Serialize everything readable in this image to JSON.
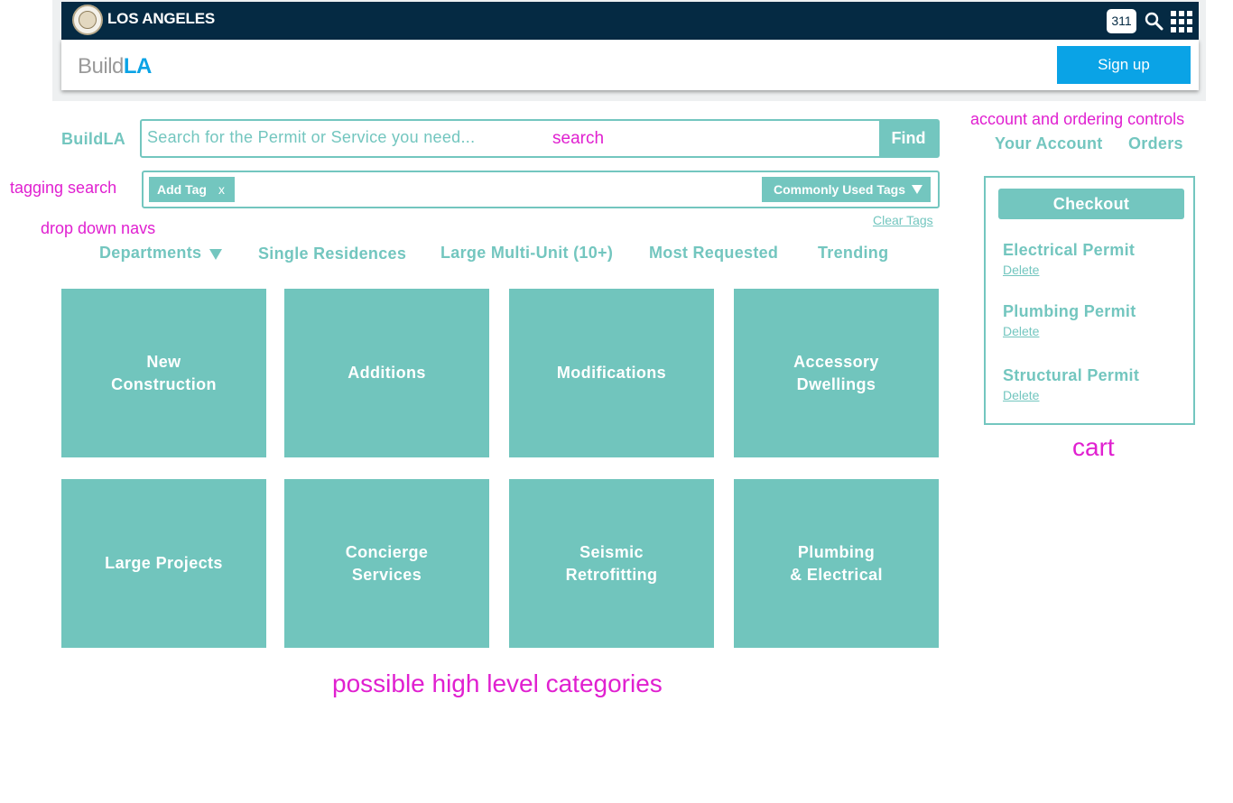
{
  "header": {
    "city_title": "LOS ANGELES",
    "badge_311": "311",
    "icons": [
      "city-seal-icon",
      "search-icon",
      "apps-grid-icon"
    ],
    "brand_colors": {
      "top_bar": "#052a43",
      "accent": "#0aa3e6",
      "teal": "#73c6bf",
      "annotation": "#e020d0"
    }
  },
  "buildbar": {
    "logo_part1": "Build",
    "logo_part2": "LA",
    "signup_label": "Sign up"
  },
  "search": {
    "side_label": "BuildLA",
    "placeholder": "Search for the Permit or Service you need...",
    "find_label": "Find"
  },
  "tags": {
    "add_tag_label": "Add Tag",
    "remove_label": "x",
    "common_tags_label": "Commonly Used Tags",
    "clear_tags_label": "Clear Tags"
  },
  "nav": {
    "departments": "Departments",
    "single_residences": "Single Residences",
    "large_multi_unit": "Large Multi-Unit (10+)",
    "most_requested": "Most Requested",
    "trending": "Trending"
  },
  "tiles": [
    "New\nConstruction",
    "Additions",
    "Modifications",
    "Accessory\nDwellings",
    "Large Projects",
    "Concierge\nServices",
    "Seismic\nRetrofitting",
    "Plumbing\n& Electrical"
  ],
  "account": {
    "your_account": "Your Account",
    "orders": "Orders"
  },
  "cart": {
    "checkout_label": "Checkout",
    "items": [
      {
        "name": "Electrical Permit",
        "delete": "Delete"
      },
      {
        "name": "Plumbing Permit",
        "delete": "Delete"
      },
      {
        "name": "Structural Permit",
        "delete": "Delete"
      }
    ]
  },
  "annotations": {
    "search": "search",
    "tagging_search": "tagging search",
    "drop_down_navs": "drop down navs",
    "account_controls": "account and ordering controls",
    "cart": "cart",
    "categories": "possible high level categories"
  }
}
